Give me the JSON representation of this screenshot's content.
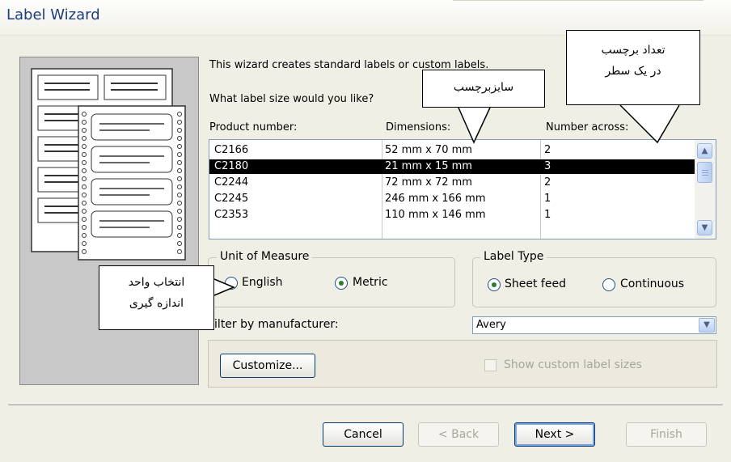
{
  "window": {
    "title": "Label Wizard"
  },
  "intro": {
    "line1": "This wizard creates standard labels or custom labels.",
    "line2": "What label size would you like?"
  },
  "columns": [
    "Product number:",
    "Dimensions:",
    "Number across:"
  ],
  "rows": [
    {
      "product": "C2166",
      "dimensions": "52 mm x 70 mm",
      "across": "2",
      "selected": false
    },
    {
      "product": "C2180",
      "dimensions": "21 mm x 15 mm",
      "across": "3",
      "selected": true
    },
    {
      "product": "C2244",
      "dimensions": "72 mm x 72 mm",
      "across": "2",
      "selected": false
    },
    {
      "product": "C2245",
      "dimensions": "246 mm x 166 mm",
      "across": "1",
      "selected": false
    },
    {
      "product": "C2353",
      "dimensions": "110 mm x 146 mm",
      "across": "1",
      "selected": false
    }
  ],
  "unit_of_measure": {
    "label": "Unit of Measure",
    "options": [
      "English",
      "Metric"
    ],
    "selected": "Metric"
  },
  "label_type": {
    "label": "Label Type",
    "options": [
      "Sheet feed",
      "Continuous"
    ],
    "selected": "Sheet feed"
  },
  "filter": {
    "label": "Filter by  manufacturer:",
    "value": "Avery"
  },
  "customize_label": "Customize...",
  "show_custom_label": "Show custom label sizes",
  "buttons": {
    "cancel": "Cancel",
    "back": "< Back",
    "next": "Next >",
    "finish": "Finish"
  },
  "callouts": {
    "size": "سایزبرچسب",
    "count_line1": "تعداد برچسب",
    "count_line2": "در یک سطر",
    "unit_line1": "انتخاب واحد",
    "unit_line2": "اندازه گیری"
  }
}
